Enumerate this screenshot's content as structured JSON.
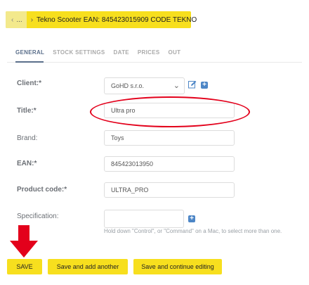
{
  "breadcrumb": {
    "home_dots": "...",
    "current": "Tekno Scooter EAN: 845423015909 CODE TEKNO"
  },
  "tabs": [
    {
      "label": "GENERAL",
      "active": true
    },
    {
      "label": "STOCK SETTINGS",
      "active": false
    },
    {
      "label": "DATE",
      "active": false
    },
    {
      "label": "PRICES",
      "active": false
    },
    {
      "label": "OUT",
      "active": false
    }
  ],
  "form": {
    "client": {
      "label": "Client:*",
      "value": "GoHD s.r.o."
    },
    "title": {
      "label": "Title:*",
      "value": "Ultra pro"
    },
    "brand": {
      "label": "Brand:",
      "value": "Toys"
    },
    "ean": {
      "label": "EAN:*",
      "value": "845423013950"
    },
    "product_code": {
      "label": "Product code:*",
      "value": "ULTRA_PRO"
    },
    "specification": {
      "label": "Specification:",
      "help": "Hold down \"Control\", or \"Command\" on a Mac, to select more than one."
    }
  },
  "buttons": {
    "save": "SAVE",
    "save_add": "Save and add another",
    "save_continue": "Save and continue editing"
  },
  "colors": {
    "accent": "#f7df1e",
    "annotation": "#e3001b",
    "add_icon": "#4d86c6"
  },
  "icons": {
    "edit": "edit-icon",
    "add": "add-icon",
    "arrow": "arrow-down-icon"
  }
}
